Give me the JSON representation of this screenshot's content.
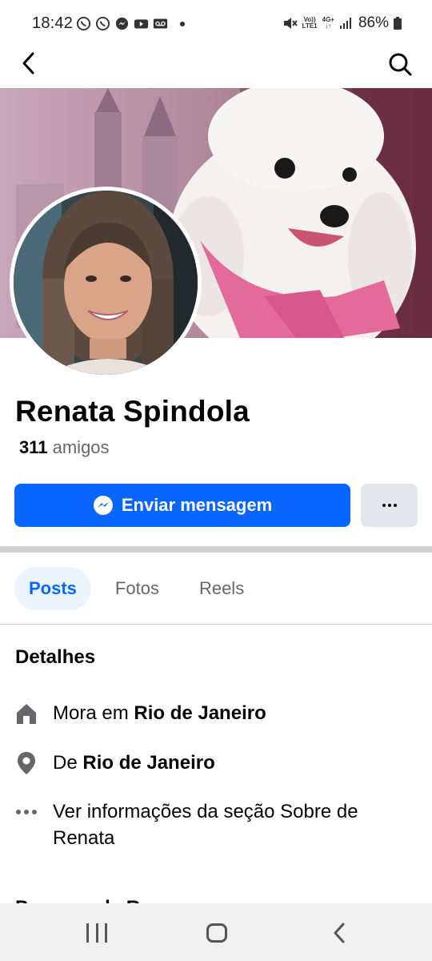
{
  "status_bar": {
    "time": "18:42",
    "left_icons": [
      "whatsapp-icon",
      "whatsapp-business-icon",
      "messenger-icon",
      "youtube-icon",
      "voicemail-icon"
    ],
    "volte_top": "Vo))",
    "volte_bottom": "LTE1",
    "network": "4G+",
    "battery": "86%"
  },
  "profile": {
    "name": "Renata Spindola",
    "friends_count": "311",
    "friends_label": "amigos"
  },
  "actions": {
    "message_label": "Enviar mensagem"
  },
  "tabs": [
    {
      "label": "Posts",
      "active": true
    },
    {
      "label": "Fotos",
      "active": false
    },
    {
      "label": "Reels",
      "active": false
    }
  ],
  "details": {
    "title": "Detalhes",
    "lives_prefix": "Mora em",
    "lives_city": "Rio de Janeiro",
    "from_prefix": "De",
    "from_city": "Rio de Janeiro",
    "about_line1": "Ver informações da seção Sobre de",
    "about_line2": "Renata"
  },
  "cutoff_text": "Pessoas de R",
  "colors": {
    "accent": "#0866ff",
    "tab_active_bg": "#ebf5ff",
    "secondary_text": "#65676b",
    "more_button_bg": "#e4e6eb"
  }
}
